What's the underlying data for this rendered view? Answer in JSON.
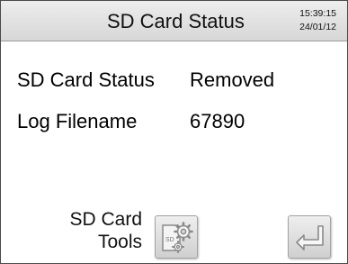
{
  "header": {
    "title": "SD Card Status",
    "time": "15:39:15",
    "date": "24/01/12"
  },
  "status": [
    {
      "label": "SD Card Status",
      "value": "Removed"
    },
    {
      "label": "Log Filename",
      "value": "67890"
    }
  ],
  "actions": {
    "tools_line1": "SD Card",
    "tools_line2": "Tools",
    "tools_icon": "sd-card-gear-icon",
    "sd_icon_text": "SD",
    "enter_icon": "enter-return-icon"
  }
}
